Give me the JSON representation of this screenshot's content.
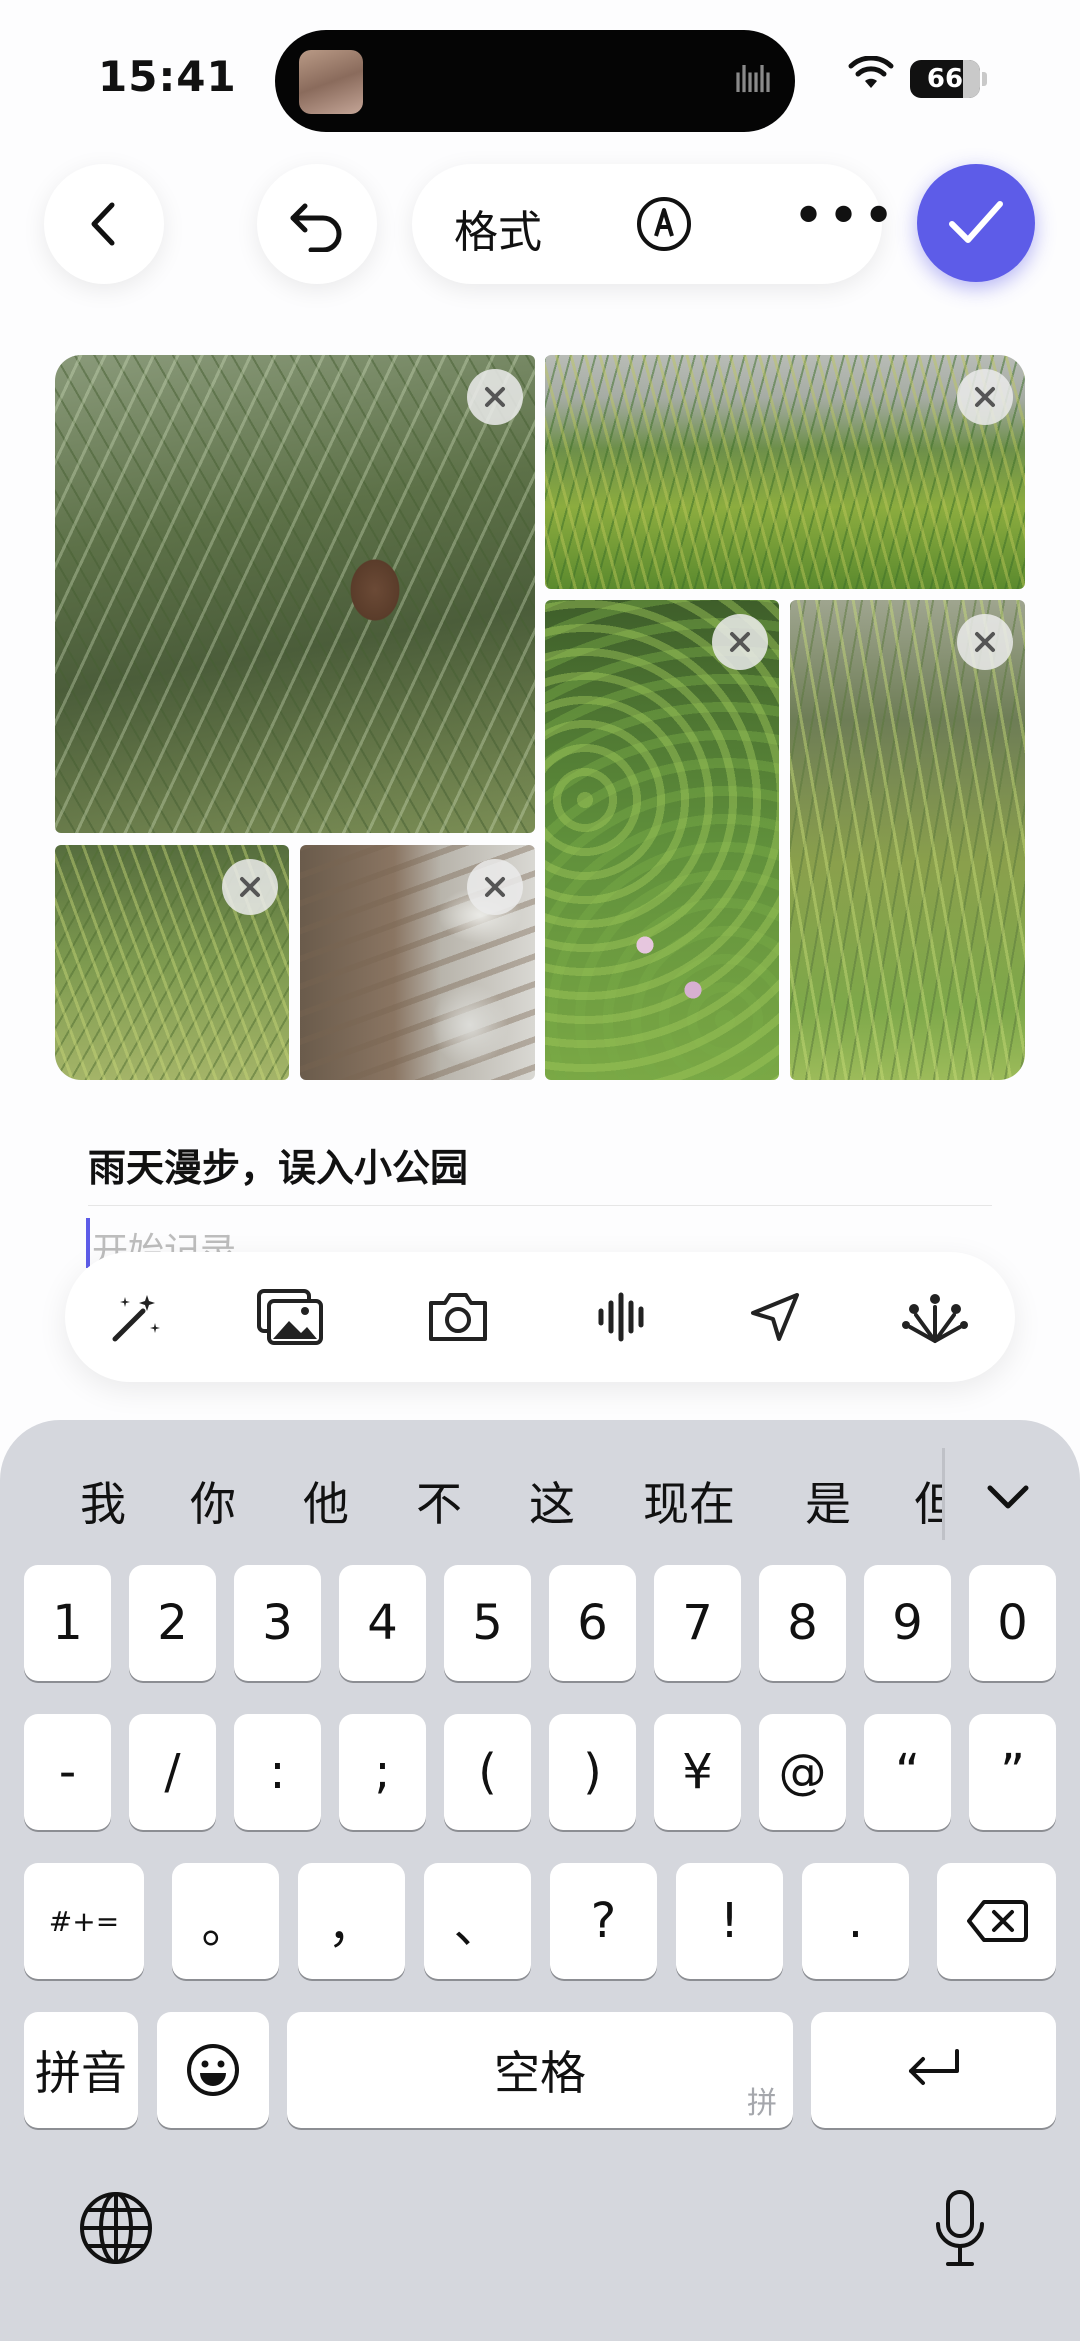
{
  "status_bar": {
    "time": "15:41",
    "battery": "66"
  },
  "toolbar": {
    "format_label": "格式",
    "more_label": "•••"
  },
  "note": {
    "title": "雨天漫步，误入小公园",
    "body_placeholder": "开始记录"
  },
  "photos": [
    {
      "name": "pine-branch-with-cone"
    },
    {
      "name": "grass-in-fog"
    },
    {
      "name": "flowering-shrub"
    },
    {
      "name": "pine-tree"
    },
    {
      "name": "young-pine-on-grass"
    },
    {
      "name": "waterfall-rocks"
    }
  ],
  "insert_bar": {
    "icons": [
      "magic-wand-icon",
      "photo-gallery-icon",
      "camera-icon",
      "waveform-icon",
      "location-arrow-icon",
      "sparkle-burst-icon"
    ]
  },
  "keyboard": {
    "candidates": [
      "我",
      "你",
      "他",
      "不",
      "这",
      "现在",
      "是",
      "但"
    ],
    "row1": [
      "1",
      "2",
      "3",
      "4",
      "5",
      "6",
      "7",
      "8",
      "9",
      "0"
    ],
    "row2": [
      "-",
      "/",
      ":",
      ";",
      "(",
      ")",
      "¥",
      "@",
      "“",
      "”"
    ],
    "row3": [
      "。",
      "，",
      "、",
      "?",
      "!",
      "."
    ],
    "symbols_key": "#+=",
    "pinyin_key": "拼音",
    "space_key": "空格",
    "space_hint": "拼"
  },
  "colors": {
    "accent": "#5d5ce8",
    "keyboard_bg": "#d5d7dd"
  }
}
